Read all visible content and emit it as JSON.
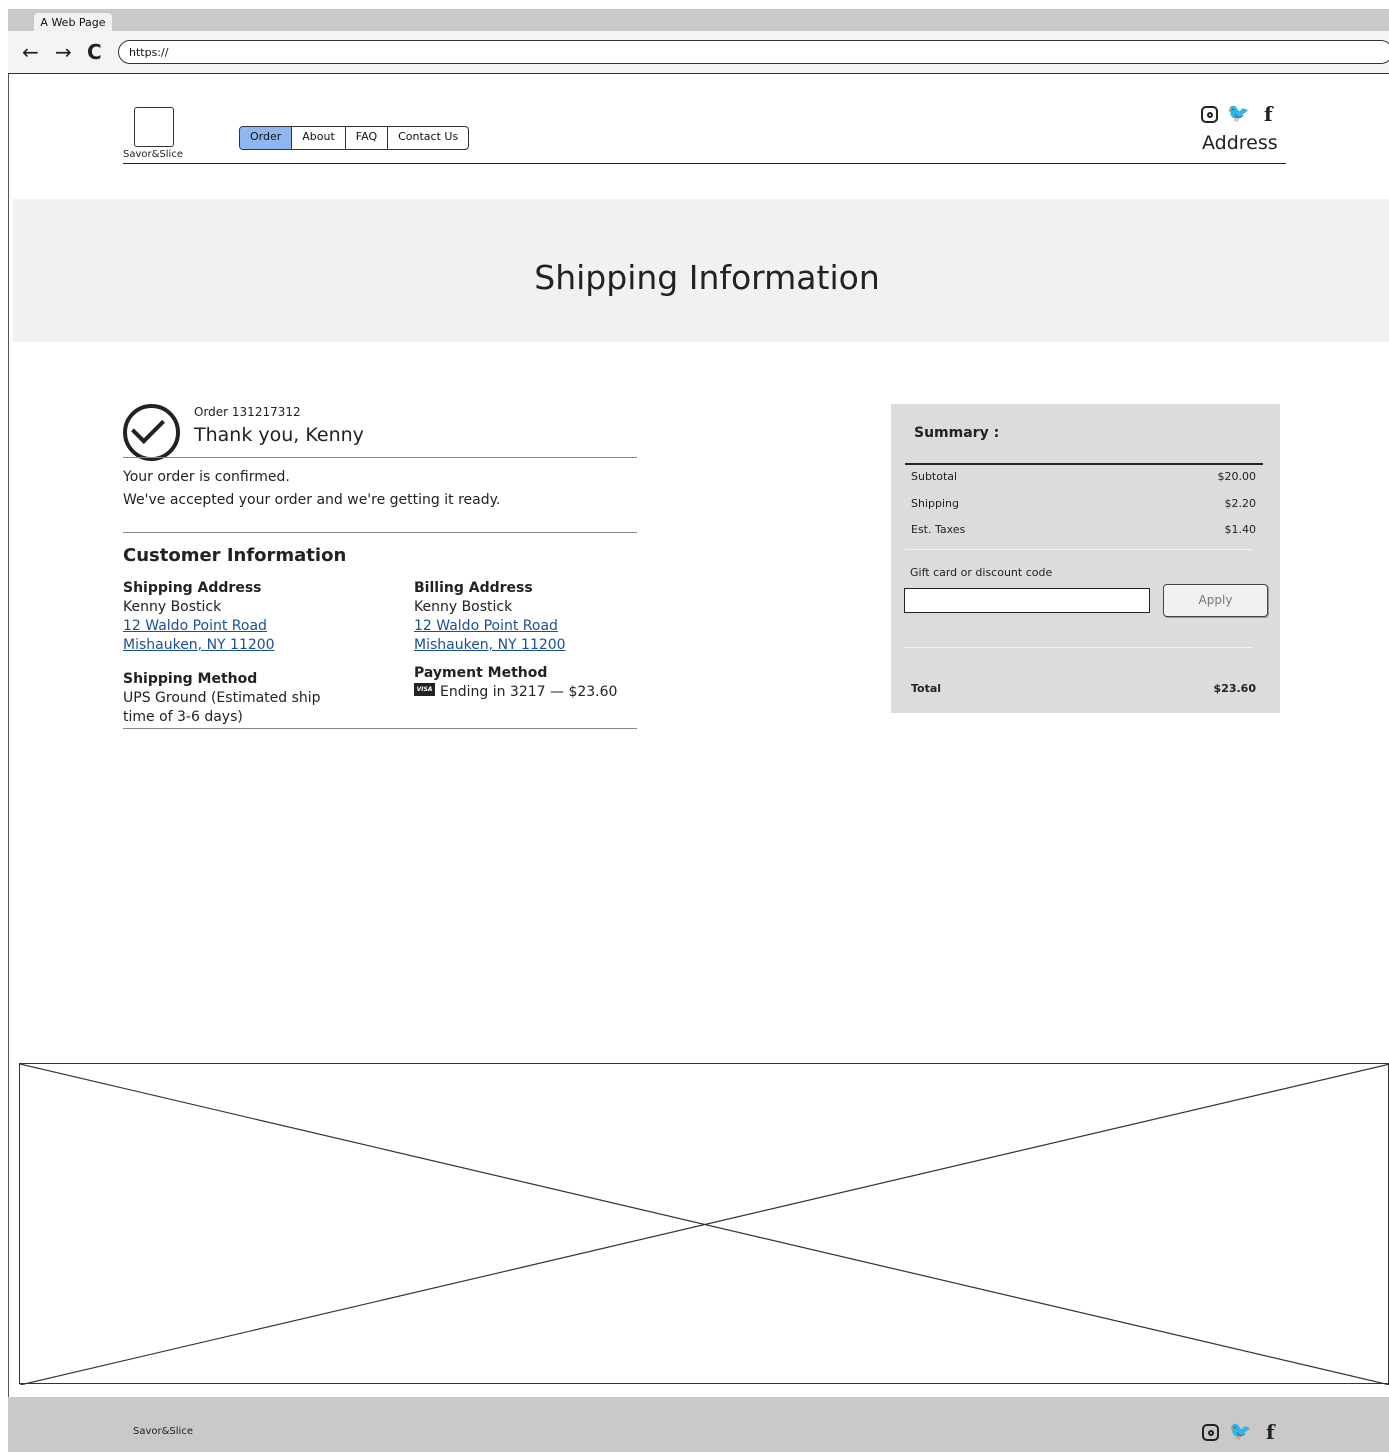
{
  "browser": {
    "tab_title": "A Web Page",
    "url": "https://",
    "back_icon": "←",
    "forward_icon": "→",
    "reload_icon": "C"
  },
  "header": {
    "logo_text": "Savor&Slice",
    "nav": [
      "Order",
      "About",
      "FAQ",
      "Contact Us"
    ],
    "active_nav": "Order",
    "address_label": "Address",
    "social_icons": [
      "instagram-icon",
      "twitter-icon",
      "facebook-icon"
    ],
    "twitter_glyph": "🐦",
    "facebook_glyph": "f"
  },
  "hero": {
    "title": "Shipping Information"
  },
  "order": {
    "number_text": "Order 131217312",
    "thanks_text": "Thank you, Kenny",
    "confirmed_text": "Your order is confirmed.",
    "accepted_text": "We've accepted your order and we're getting it ready."
  },
  "customer": {
    "heading": "Customer Information",
    "shipping_address": {
      "label": "Shipping Address",
      "name": "Kenny Bostick",
      "line1": "12 Waldo Point Road",
      "line2": "Mishauken, NY 11200"
    },
    "billing_address": {
      "label": "Billing Address",
      "name": "Kenny Bostick",
      "line1": "12 Waldo Point Road",
      "line2": "Mishauken, NY 11200"
    },
    "shipping_method": {
      "label": "Shipping Method",
      "line1": "UPS Ground (Estimated ship",
      "line2": "time of 3-6 days)"
    },
    "payment_method": {
      "label": "Payment Method",
      "card_badge": "VISA",
      "text": "Ending in 3217 — $23.60"
    }
  },
  "summary": {
    "title": "Summary :",
    "rows": [
      {
        "label": "Subtotal",
        "value": "$20.00"
      },
      {
        "label": "Shipping",
        "value": "$2.20"
      },
      {
        "label": "Est. Taxes",
        "value": "$1.40"
      }
    ],
    "gift_label": "Gift card or discount code",
    "gift_value": "",
    "apply_label": "Apply",
    "total_label": "Total",
    "total_value": "$23.60"
  },
  "footer": {
    "logo_text": "Savor&Slice"
  },
  "colors": {
    "active_nav": "#8fb6ef",
    "link": "#1a4f97",
    "summary_bg": "#dcdcdc",
    "hero_bg": "#f1f1f1",
    "chrome": "#c9c9c9"
  }
}
